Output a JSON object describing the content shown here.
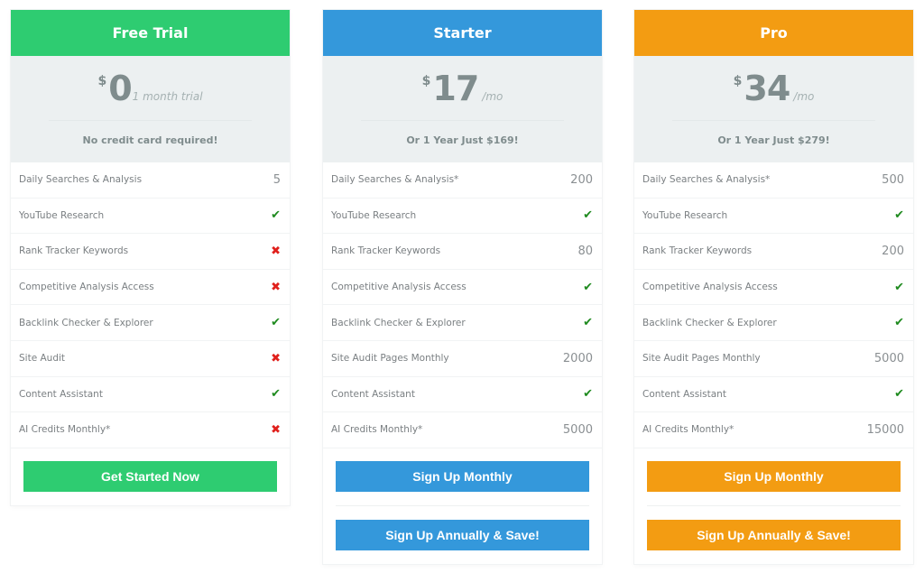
{
  "plans": [
    {
      "name": "Free Trial",
      "color": "#2ecc71",
      "currency": "$",
      "amount": "0",
      "period": "1 month trial",
      "note": "No credit card required!",
      "features": [
        {
          "label": "Daily Searches & Analysis",
          "value": "5",
          "type": "text"
        },
        {
          "label": "YouTube Research",
          "value": "check",
          "type": "check"
        },
        {
          "label": "Rank Tracker Keywords",
          "value": "cross",
          "type": "cross"
        },
        {
          "label": "Competitive Analysis Access",
          "value": "cross",
          "type": "cross"
        },
        {
          "label": "Backlink Checker & Explorer",
          "value": "check",
          "type": "check"
        },
        {
          "label": "Site Audit",
          "value": "cross",
          "type": "cross"
        },
        {
          "label": "Content Assistant",
          "value": "check",
          "type": "check"
        },
        {
          "label": "AI Credits Monthly*",
          "value": "cross",
          "type": "cross"
        }
      ],
      "buttons": [
        {
          "label": "Get Started Now"
        }
      ]
    },
    {
      "name": "Starter",
      "color": "#3498db",
      "currency": "$",
      "amount": "17",
      "period": "/mo",
      "note": "Or 1 Year Just $169!",
      "features": [
        {
          "label": "Daily Searches & Analysis*",
          "value": "200",
          "type": "text"
        },
        {
          "label": "YouTube Research",
          "value": "check",
          "type": "check"
        },
        {
          "label": "Rank Tracker Keywords",
          "value": "80",
          "type": "text"
        },
        {
          "label": "Competitive Analysis Access",
          "value": "check",
          "type": "check"
        },
        {
          "label": "Backlink Checker & Explorer",
          "value": "check",
          "type": "check"
        },
        {
          "label": "Site Audit Pages Monthly",
          "value": "2000",
          "type": "text"
        },
        {
          "label": "Content Assistant",
          "value": "check",
          "type": "check"
        },
        {
          "label": "AI Credits Monthly*",
          "value": "5000",
          "type": "text"
        }
      ],
      "buttons": [
        {
          "label": "Sign Up Monthly"
        },
        {
          "label": "Sign Up Annually & Save!"
        }
      ]
    },
    {
      "name": "Pro",
      "color": "#f39c12",
      "currency": "$",
      "amount": "34",
      "period": "/mo",
      "note": "Or 1 Year Just $279!",
      "features": [
        {
          "label": "Daily Searches & Analysis*",
          "value": "500",
          "type": "text"
        },
        {
          "label": "YouTube Research",
          "value": "check",
          "type": "check"
        },
        {
          "label": "Rank Tracker Keywords",
          "value": "200",
          "type": "text"
        },
        {
          "label": "Competitive Analysis Access",
          "value": "check",
          "type": "check"
        },
        {
          "label": "Backlink Checker & Explorer",
          "value": "check",
          "type": "check"
        },
        {
          "label": "Site Audit Pages Monthly",
          "value": "5000",
          "type": "text"
        },
        {
          "label": "Content Assistant",
          "value": "check",
          "type": "check"
        },
        {
          "label": "AI Credits Monthly*",
          "value": "15000",
          "type": "text"
        }
      ],
      "buttons": [
        {
          "label": "Sign Up Monthly"
        },
        {
          "label": "Sign Up Annually & Save!"
        }
      ]
    }
  ],
  "icons": {
    "check": "✔",
    "cross": "✖"
  },
  "colors": {
    "price_bg": "#ecf0f1",
    "price_text": "#7f8c8d",
    "check": "#1e8a1e",
    "cross": "#e0201c"
  }
}
